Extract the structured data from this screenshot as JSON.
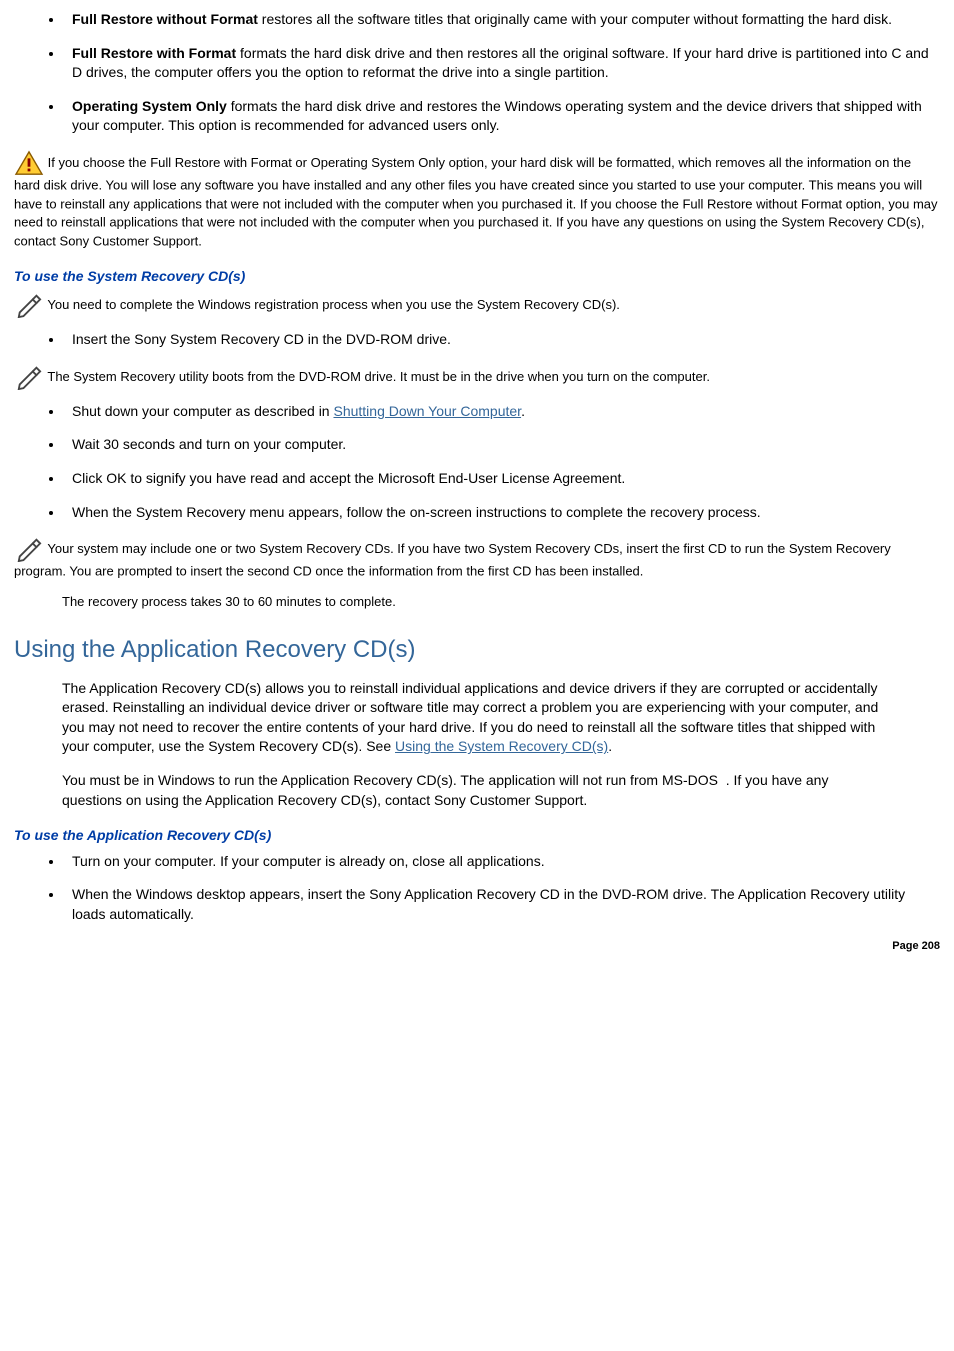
{
  "options": [
    {
      "title": "Full Restore without Format",
      "desc": " restores all the software titles that originally came with your computer without formatting the hard disk."
    },
    {
      "title": "Full Restore with Format",
      "desc": " formats the hard disk drive and then restores all the original software. If your hard drive is partitioned into C and D drives, the computer offers you the option to reformat the drive into a single partition."
    },
    {
      "title": "Operating System Only",
      "desc": " formats the hard disk drive and restores the Windows operating system and the device drivers that shipped with your computer. This option is recommended for advanced users only."
    }
  ],
  "warning_text": " If you choose the Full Restore with Format or Operating System Only option, your hard disk will be formatted, which removes all the information on the hard disk drive. You will lose any software you have installed and any other files you have created since you started to use your computer. This means you will have to reinstall any applications that were not included with the computer when you purchased it. If you choose the Full Restore without Format option, you may need to reinstall applications that were not included with the computer when you purchased it. If you have any questions on using the System Recovery CD(s), contact Sony Customer Support.",
  "subheading1": "To use the System Recovery CD(s)",
  "note1": " You need to complete the Windows registration process when you use the System Recovery CD(s).",
  "step_insert": "Insert the Sony System Recovery CD in the DVD-ROM drive.",
  "note2": " The System Recovery utility boots from the DVD-ROM drive. It must be in the drive when you turn on the computer.",
  "steps2_pre": "Shut down your computer as described in ",
  "steps2_link": "Shutting Down Your Computer",
  "steps2_post": ".",
  "step_wait": "Wait 30 seconds and turn on your computer.",
  "step_ok": "Click OK to signify you have read and accept the Microsoft End-User License Agreement.",
  "step_menu": "When the System Recovery menu appears, follow the on-screen instructions to complete the recovery process.",
  "note3": " Your system may include one or two System Recovery CDs. If you have two System Recovery CDs, insert the first CD to run the System Recovery program. You are prompted to insert the second CD once the information from the first CD has been installed.",
  "recovery_time": "The recovery process takes 30 to 60 minutes to complete.",
  "section_heading": "Using the Application Recovery CD(s)",
  "app_para1_pre": "The Application Recovery CD(s) allows you to reinstall individual applications and device drivers if they are corrupted or accidentally erased. Reinstalling an individual device driver or software title may correct a problem you are experiencing with your computer, and you may not need to recover the entire contents of your hard drive. If you do need to reinstall all the software titles that shipped with your computer, use the System Recovery CD(s). See ",
  "app_para1_link": "Using the System Recovery CD(s)",
  "app_para1_post": ".",
  "app_para2": "You must be in Windows to run the Application Recovery CD(s). The application will not run from MS-DOS  . If you have any questions on using the Application Recovery CD(s), contact Sony Customer Support.",
  "subheading2": "To use the Application Recovery CD(s)",
  "app_step1": "Turn on your computer. If your computer is already on, close all applications.",
  "app_step2": "When the Windows desktop appears, insert the Sony Application Recovery CD in the DVD-ROM drive. The Application Recovery utility loads automatically.",
  "page_number": "Page 208"
}
